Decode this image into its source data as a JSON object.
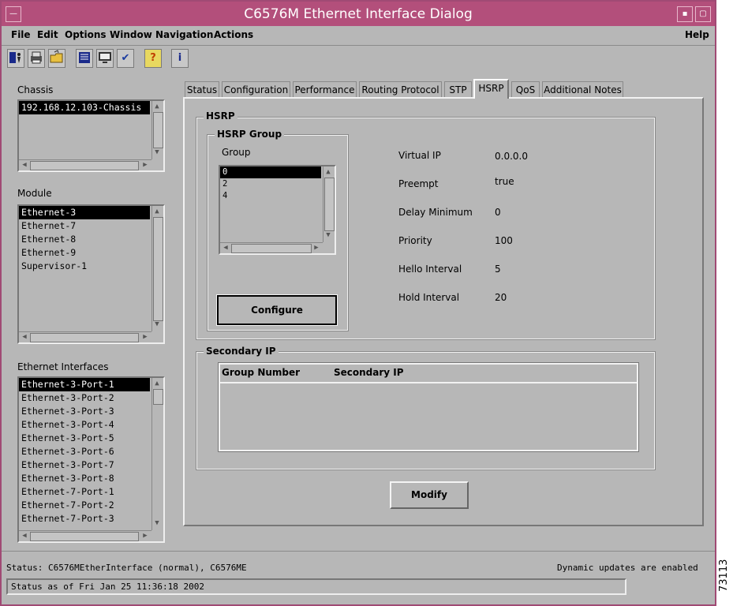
{
  "window": {
    "title": "C6576M Ethernet Interface Dialog"
  },
  "menu": {
    "file": "File",
    "edit": "Edit",
    "options": "Options",
    "window": "Window",
    "navigation": "Navigation",
    "actions": "Actions",
    "help": "Help"
  },
  "toolbar_icons": [
    "exit-icon",
    "print-icon",
    "open-folder-icon",
    "list-icon",
    "monitor-icon",
    "checkmark-icon",
    "help-icon",
    "info-icon"
  ],
  "toolbar_glyphs": {
    "help": "?",
    "info": "i",
    "check": "✔"
  },
  "left": {
    "chassis_label": "Chassis",
    "chassis_items": [
      "192.168.12.103-Chassis"
    ],
    "module_label": "Module",
    "module_items": [
      "Ethernet-3",
      "Ethernet-7",
      "Ethernet-8",
      "Ethernet-9",
      "Supervisor-1"
    ],
    "eth_label": "Ethernet Interfaces",
    "eth_items": [
      "Ethernet-3-Port-1",
      "Ethernet-3-Port-2",
      "Ethernet-3-Port-3",
      "Ethernet-3-Port-4",
      "Ethernet-3-Port-5",
      "Ethernet-3-Port-6",
      "Ethernet-3-Port-7",
      "Ethernet-3-Port-8",
      "Ethernet-7-Port-1",
      "Ethernet-7-Port-2",
      "Ethernet-7-Port-3"
    ]
  },
  "tabs": [
    {
      "label": "Status"
    },
    {
      "label": "Configuration"
    },
    {
      "label": "Performance"
    },
    {
      "label": "Routing Protocol"
    },
    {
      "label": "STP"
    },
    {
      "label": "HSRP"
    },
    {
      "label": "QoS"
    },
    {
      "label": "Additional Notes"
    }
  ],
  "hsrp": {
    "section_title": "HSRP",
    "group_box_title": "HSRP Group",
    "group_label": "Group",
    "group_items": [
      "0",
      "2",
      "4"
    ],
    "configure_label": "Configure",
    "fields": [
      {
        "label": "Virtual IP",
        "value": "0.0.0.0"
      },
      {
        "label": "Preempt",
        "value": "true"
      },
      {
        "label": "Delay Minimum",
        "value": "0"
      },
      {
        "label": "Priority",
        "value": "100"
      },
      {
        "label": "Hello Interval",
        "value": "5"
      },
      {
        "label": "Hold Interval",
        "value": "20"
      }
    ]
  },
  "secondary": {
    "title": "Secondary IP",
    "columns": [
      "Group Number",
      "Secondary IP"
    ]
  },
  "modify_label": "Modify",
  "status": {
    "line1": "Status: C6576MEtherInterface (normal), C6576ME",
    "updates": "Dynamic updates are enabled",
    "line2": "Status as of Fri Jan 25 11:36:18 2002"
  },
  "figure_id": "73113",
  "colors": {
    "titlebar": "#b34f7b",
    "window_bg": "#b7b7b7"
  }
}
